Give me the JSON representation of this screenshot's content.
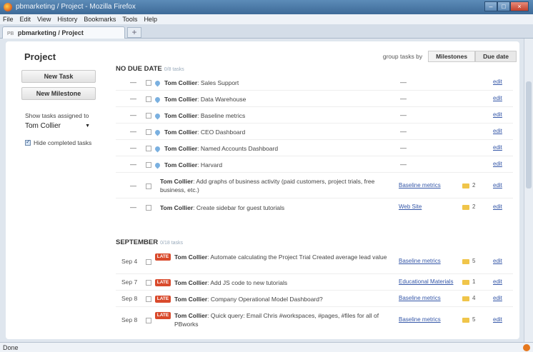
{
  "window": {
    "title": "pbmarketing / Project - Mozilla Firefox",
    "controls": [
      "–",
      "□",
      "×"
    ]
  },
  "menu": [
    "File",
    "Edit",
    "View",
    "History",
    "Bookmarks",
    "Tools",
    "Help"
  ],
  "tab": {
    "favicon": "PB",
    "label": "pbmarketing / Project",
    "new_tab": "+"
  },
  "sidebar": {
    "title": "Project",
    "new_task": "New Task",
    "new_milestone": "New Milestone",
    "show_label": "Show tasks assigned to",
    "assignee": "Tom Collier",
    "hide_completed": "Hide completed tasks"
  },
  "group_by": {
    "label": "group tasks by",
    "milestones": "Milestones",
    "due_date": "Due date"
  },
  "sections": {
    "no_due": {
      "title": "NO DUE DATE",
      "count": "0/8 tasks"
    },
    "september": {
      "title": "SEPTEMBER",
      "count": "0/18 tasks"
    }
  },
  "no_due_tasks": [
    {
      "dash": "—",
      "person": "Tom Collier",
      "text": ": Sales Support",
      "milestone": "—",
      "files": "",
      "edit": "edit"
    },
    {
      "dash": "—",
      "person": "Tom Collier",
      "text": ": Data Warehouse",
      "milestone": "—",
      "files": "",
      "edit": "edit"
    },
    {
      "dash": "—",
      "person": "Tom Collier",
      "text": ": Baseline metrics",
      "milestone": "—",
      "files": "",
      "edit": "edit"
    },
    {
      "dash": "—",
      "person": "Tom Collier",
      "text": ": CEO Dashboard",
      "milestone": "—",
      "files": "",
      "edit": "edit"
    },
    {
      "dash": "—",
      "person": "Tom Collier",
      "text": ": Named Accounts Dashboard",
      "milestone": "—",
      "files": "",
      "edit": "edit"
    },
    {
      "dash": "—",
      "person": "Tom Collier",
      "text": ": Harvard",
      "milestone": "—",
      "files": "",
      "edit": "edit"
    },
    {
      "dash": "—",
      "person": "Tom Collier",
      "text": ": Add graphs of business activity (paid customers, project trials, free business, etc.)",
      "milestone": "Baseline metrics",
      "files": "2",
      "edit": "edit"
    },
    {
      "dash": "—",
      "person": "Tom Collier",
      "text": ": Create sidebar for guest tutorials",
      "milestone": "Web Site",
      "files": "2",
      "edit": "edit"
    }
  ],
  "september_tasks": [
    {
      "date": "Sep 4",
      "late": "LATE",
      "person": "Tom Collier",
      "text": ": Automate calculating the Project Trial Created average lead value",
      "milestone": "Baseline metrics",
      "files": "5",
      "edit": "edit"
    },
    {
      "date": "Sep 7",
      "late": "LATE",
      "person": "Tom Collier",
      "text": ": Add JS code to new tutorials",
      "milestone": "Educational Materials",
      "files": "1",
      "edit": "edit"
    },
    {
      "date": "Sep 8",
      "late": "LATE",
      "person": "Tom Collier",
      "text": ": Company Operational Model Dashboard?",
      "milestone": "Baseline metrics",
      "files": "4",
      "edit": "edit"
    },
    {
      "date": "Sep 8",
      "late": "LATE",
      "person": "Tom Collier",
      "text": ": Quick query: Email Chris #workspaces, #pages, #files for all of PBworks",
      "milestone": "Baseline metrics",
      "files": "5",
      "edit": "edit"
    }
  ],
  "status": "Done"
}
